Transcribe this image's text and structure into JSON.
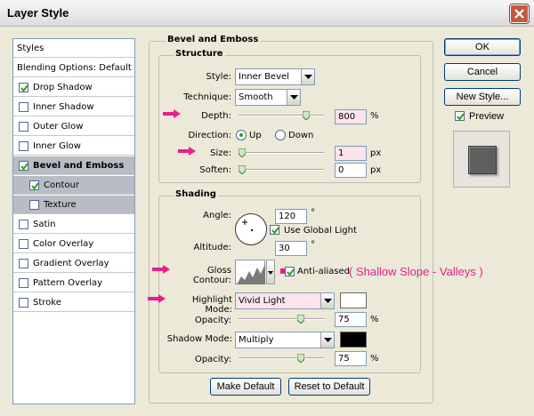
{
  "window": {
    "title": "Layer Style"
  },
  "styles_list": {
    "header": "Styles",
    "blending": "Blending Options: Default",
    "items": [
      {
        "label": "Drop Shadow",
        "checked": true
      },
      {
        "label": "Inner Shadow",
        "checked": false
      },
      {
        "label": "Outer Glow",
        "checked": false
      },
      {
        "label": "Inner Glow",
        "checked": false
      },
      {
        "label": "Bevel and Emboss",
        "checked": true,
        "selected": true
      },
      {
        "label": "Contour",
        "checked": true,
        "sub": true
      },
      {
        "label": "Texture",
        "checked": false,
        "sub": true
      },
      {
        "label": "Satin",
        "checked": false
      },
      {
        "label": "Color Overlay",
        "checked": false
      },
      {
        "label": "Gradient Overlay",
        "checked": false
      },
      {
        "label": "Pattern Overlay",
        "checked": false
      },
      {
        "label": "Stroke",
        "checked": false
      }
    ]
  },
  "panel": {
    "title": "Bevel and Emboss",
    "structure": {
      "title": "Structure",
      "style_label": "Style:",
      "style_value": "Inner Bevel",
      "technique_label": "Technique:",
      "technique_value": "Smooth",
      "depth_label": "Depth:",
      "depth_value": "800",
      "depth_unit": "%",
      "depth_slider": 0.82,
      "direction_label": "Direction:",
      "direction_up": "Up",
      "direction_down": "Down",
      "direction_selected": "Up",
      "size_label": "Size:",
      "size_value": "1",
      "size_unit": "px",
      "size_slider": 0.0,
      "soften_label": "Soften:",
      "soften_value": "0",
      "soften_unit": "px",
      "soften_slider": 0.0
    },
    "shading": {
      "title": "Shading",
      "angle_label": "Angle:",
      "angle_value": "120",
      "angle_unit": "°",
      "global_light_label": "Use Global Light",
      "global_light": true,
      "altitude_label": "Altitude:",
      "altitude_value": "30",
      "altitude_unit": "°",
      "gloss_label": "Gloss Contour:",
      "antialiased_label": "Anti-aliased",
      "antialiased": true,
      "highlight_mode_label": "Highlight Mode:",
      "highlight_mode_value": "Vivid Light",
      "highlight_color": "#ffffff",
      "highlight_opacity_label": "Opacity:",
      "highlight_opacity_value": "75",
      "highlight_opacity_unit": "%",
      "highlight_opacity_slider": 0.75,
      "shadow_mode_label": "Shadow Mode:",
      "shadow_mode_value": "Multiply",
      "shadow_color": "#000000",
      "shadow_opacity_label": "Opacity:",
      "shadow_opacity_value": "75",
      "shadow_opacity_unit": "%",
      "shadow_opacity_slider": 0.75
    },
    "make_default": "Make Default",
    "reset_default": "Reset to Default"
  },
  "annotation": "( Shallow Slope - Valleys )",
  "annotation_color": "#e91e8c",
  "buttons": {
    "ok": "OK",
    "cancel": "Cancel",
    "new_style": "New Style...",
    "preview_label": "Preview",
    "preview_checked": true
  }
}
